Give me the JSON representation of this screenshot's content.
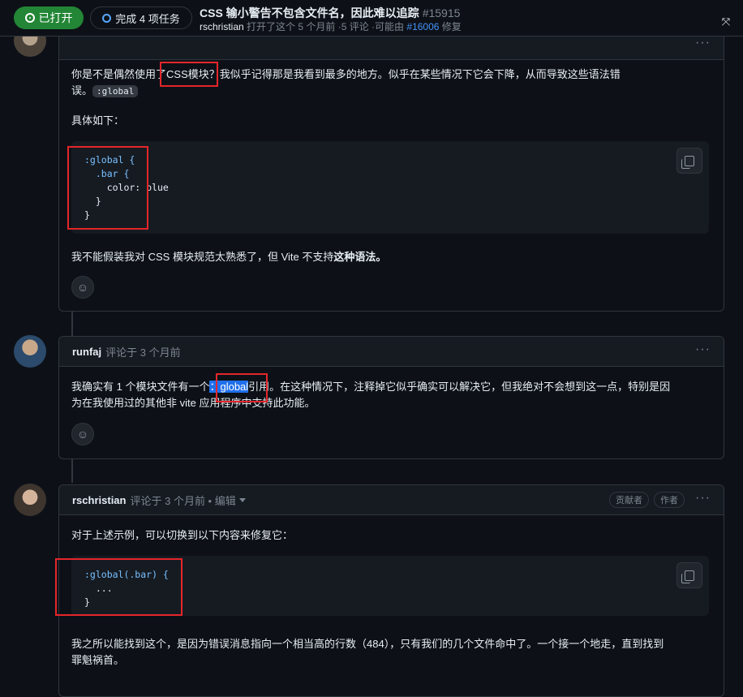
{
  "header": {
    "status_label": "已打开",
    "tasks_label": "完成 4 项任务",
    "title": "CSS 输小警告不包含文件名，因此难以追踪",
    "issue_number": "#15915",
    "sub_author": "rschristian",
    "sub_text": "打开了这个 5 个月前 ·5 评论 ·可能由",
    "sub_link": "#16006",
    "sub_tail": "修复",
    "expand_icon": "expand-icon"
  },
  "comment1": {
    "para1_pre": "你是不是偶然使用了",
    "para1_box": "CSS模块",
    "para1_post": "？我似乎记得那是我看到最多的地方。似乎在某些情况下它会下降，从而导致这些语法错",
    "para1_line2": "误。",
    "inline_code": ":global",
    "para2": "具体如下：",
    "code": [
      ":global {",
      "  .bar {",
      "    color: blue",
      "  }",
      "}"
    ],
    "para3_pre": "我不能假装我对 CSS 模块规范太熟悉了，但 Vite 不支持",
    "para3_bold": "这种语法。"
  },
  "comment2": {
    "author": "runfaj",
    "meta": "评论于 3 个月前",
    "text_pre": "我确实有 1 个模块文件有一个",
    "text_highlight": "：global",
    "text_post": "引用。在这种情况下，注释掉它似乎确实可以解决它，但我绝对不会想到这一点，特别是因",
    "text_line2": "为在我使用过的其他非 vite 应用程序中支持此功能。"
  },
  "comment3": {
    "author": "rschristian",
    "meta": "评论于 3 个月前 • 编辑",
    "pill_contributor": "贡献者",
    "pill_author": "作者",
    "para1": "对于上述示例，可以切换到以下内容来修复它：",
    "code": [
      ":global(.bar) {",
      "  ...",
      "}"
    ],
    "para2_line1": "我之所以能找到这个，是因为错误消息指向一个相当高的行数（484），只有我们的几个文件命中了。一个接一个地走，直到找到",
    "para2_line2": "罪魁祸首。"
  }
}
